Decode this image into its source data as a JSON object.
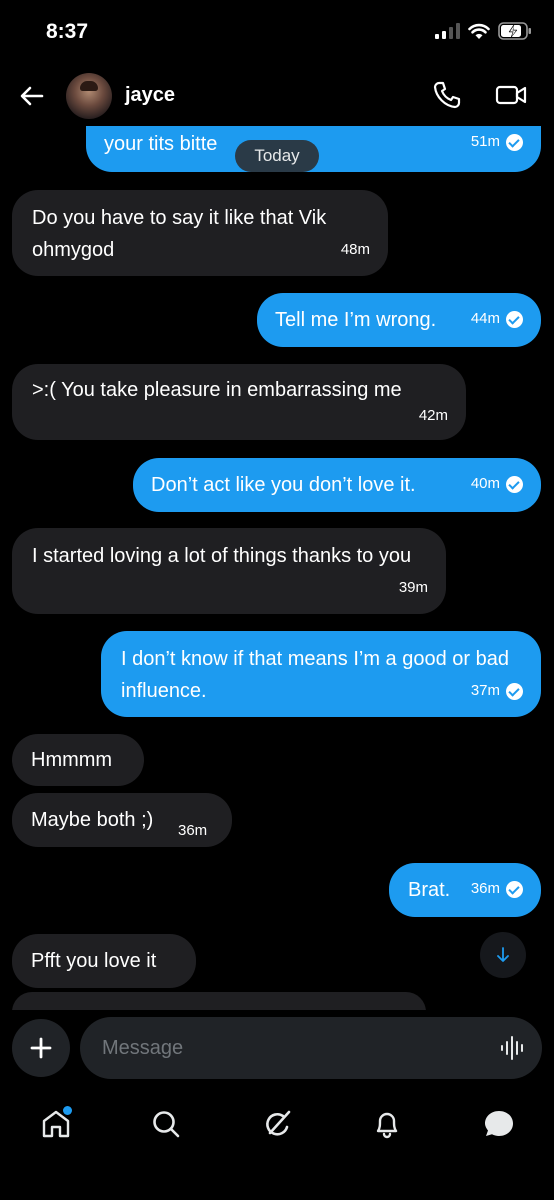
{
  "status_bar": {
    "time": "8:37",
    "battery": "75"
  },
  "header": {
    "contact_name": "jayce"
  },
  "today_label": "Today",
  "messages": [
    {
      "direction": "out",
      "text": "your tits bitte",
      "time": "51m",
      "read": true
    },
    {
      "direction": "in",
      "text": "Do you have to say it like that Vik ohmygod",
      "time": "48m"
    },
    {
      "direction": "out",
      "text": "Tell me I’m wrong.",
      "time": "44m",
      "read": true
    },
    {
      "direction": "in",
      "text": ">:( You take pleasure in embarrassing me",
      "time": "42m"
    },
    {
      "direction": "out",
      "text": "Don’t act like you don’t love it.",
      "time": "40m",
      "read": true
    },
    {
      "direction": "in",
      "text": "I started loving a lot of things thanks to you",
      "time": "39m"
    },
    {
      "direction": "out",
      "text": "I don’t know if that means I’m a good or bad influence.",
      "time": "37m",
      "read": true
    },
    {
      "direction": "in",
      "text": "Hmmmm",
      "time": ""
    },
    {
      "direction": "in",
      "text": "Maybe both ;)",
      "time": "36m"
    },
    {
      "direction": "out",
      "text": "Brat.",
      "time": "36m",
      "read": true
    },
    {
      "direction": "in",
      "text": "Pfft you love it",
      "time": ""
    }
  ],
  "composer": {
    "placeholder": "Message"
  },
  "tabbar": {
    "items": [
      "home-icon",
      "search-icon",
      "grok-icon",
      "notifications-icon",
      "messages-icon"
    ]
  },
  "colors": {
    "accent": "#1d9bf0",
    "incoming_bubble": "#1f1f22",
    "background": "#000000"
  }
}
